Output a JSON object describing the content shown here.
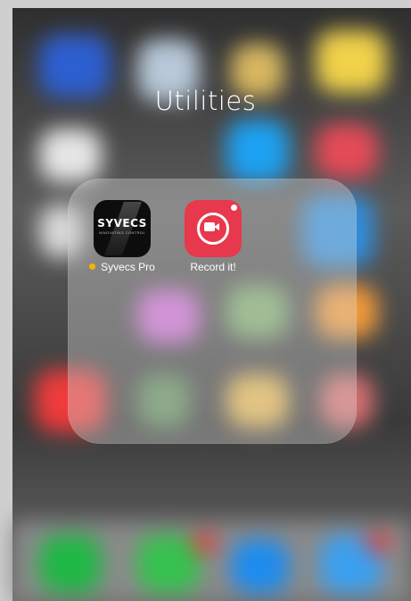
{
  "folder": {
    "title": "Utilities",
    "apps": [
      {
        "name": "Syvecs Pro",
        "icon": "syvecs-pro-app-icon",
        "logo_text": "SYVECS",
        "logo_subtext": "INNOVATING CONTROL",
        "notification_dot": true,
        "dot_color": "#f5b300"
      },
      {
        "name": "Record it!",
        "icon": "record-it-app-icon",
        "notification_dot": false,
        "icon_color": "#e8384d"
      }
    ]
  },
  "colors": {
    "folder_panel": "rgba(215,215,215,0.38)",
    "text": "#ffffff"
  }
}
